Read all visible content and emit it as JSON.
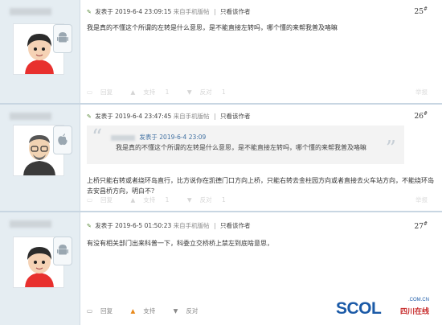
{
  "posts": [
    {
      "posted_label": "发表于",
      "time": "2019-6-4 23:09:15",
      "source": "来自手机版帖",
      "author_only": "只看该作者",
      "floor": "25",
      "body": "我是真的不懂这个所谓的左转是什么意思，是不能直接左转吗，哪个懂的来帮我普及咯嘛",
      "actions": {
        "reply": "回复",
        "support": "支持",
        "support_count": "1",
        "oppose": "反对",
        "oppose_count": "1"
      },
      "report": "举报"
    },
    {
      "posted_label": "发表于",
      "time": "2019-6-4 23:47:45",
      "source": "来自手机版帖",
      "author_only": "只看该作者",
      "floor": "26",
      "quote": {
        "meta_label": "发表于",
        "meta_time": "2019-6-4 23:09",
        "text": "我是真的不懂这个所谓的左转是什么意思，是不能直接左转吗，哪个懂的来帮我普及咯嘛"
      },
      "body": "上桥只能右转或者绕环岛直行，比方说你在凯德门口方向上桥，只能右转去金柱园方向或者直接去火车站方向，不能绕环岛去安昌桥方向，明白不？",
      "actions": {
        "reply": "回复",
        "support": "支持",
        "support_count": "1",
        "oppose": "反对",
        "oppose_count": "1"
      },
      "report": "举报"
    },
    {
      "posted_label": "发表于",
      "time": "2019-6-5 01:50:23",
      "source": "来自手机版帖",
      "author_only": "只看该作者",
      "floor": "27",
      "body": "有没有相关部门出来科普一下，科委立交桥桥上禁左到底啥意思，",
      "actions": {
        "reply": "回复",
        "support": "支持",
        "oppose": "反对"
      },
      "report": "举报"
    }
  ],
  "watermark": {
    "brand": "SCOL",
    "domain": ".COM.CN",
    "cn": "四川在线"
  },
  "icons": {
    "pencil": "pencil-icon",
    "android": "android-icon",
    "apple": "apple-icon",
    "reply": "reply-icon",
    "up": "thumb-up-icon",
    "down": "thumb-down-icon"
  },
  "colors": {
    "sidebar": "#e5edf2",
    "link": "#3e6ea0",
    "support": "#e8891b",
    "brand": "#1b5aa7",
    "brand_red": "#c62828"
  }
}
